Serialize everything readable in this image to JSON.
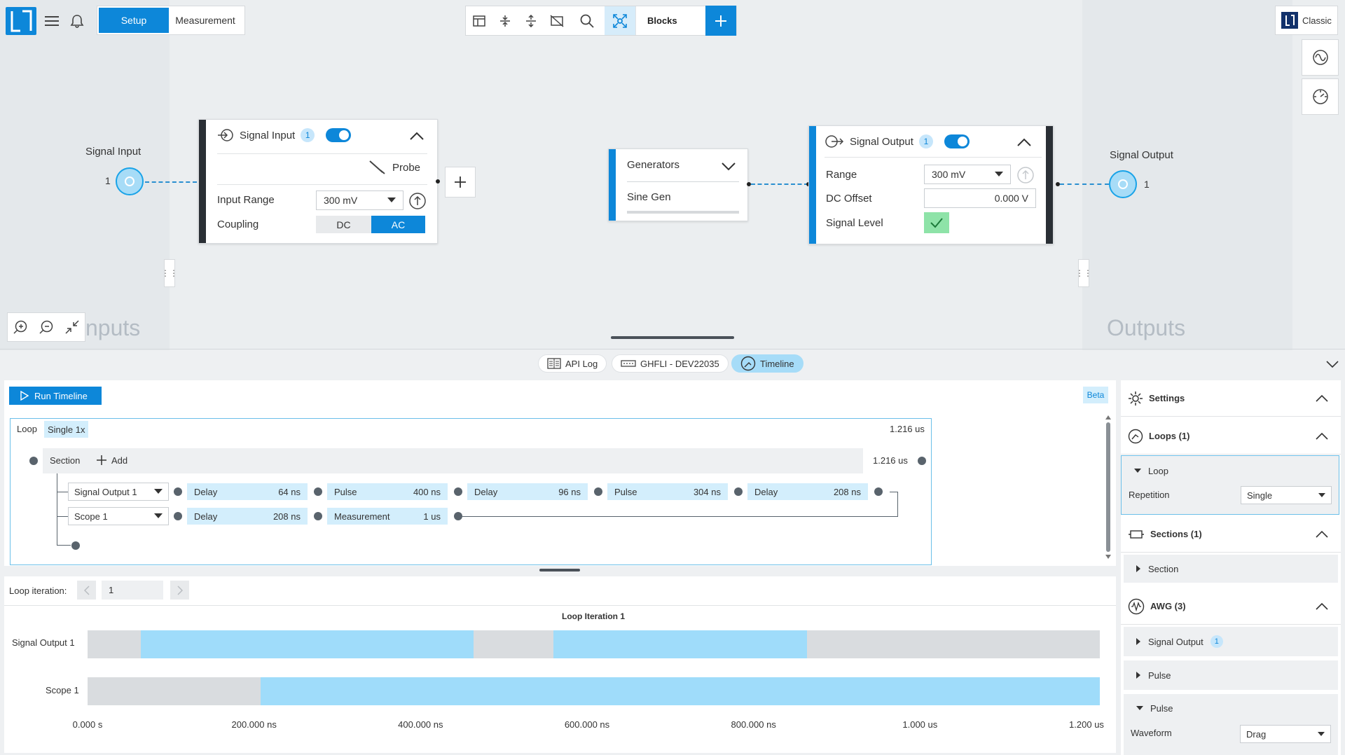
{
  "header": {
    "tabs": [
      "Setup",
      "Measurement"
    ],
    "toolbar_blocks_label": "Blocks",
    "classic_label": "Classic"
  },
  "canvas": {
    "left_area_label": "nputs",
    "right_area_label": "Outputs",
    "signal_input_port": {
      "label": "Signal Input",
      "number": "1"
    },
    "signal_output_port": {
      "label": "Signal Output",
      "number": "1"
    },
    "signal_input_block": {
      "title": "Signal Input",
      "badge": "1",
      "probe_label": "Probe",
      "input_range_label": "Input Range",
      "input_range_value": "300 mV",
      "coupling_label": "Coupling",
      "coupling_options": [
        "DC",
        "AC"
      ],
      "coupling_selected": "AC"
    },
    "generators_block": {
      "title": "Generators",
      "item": "Sine Gen"
    },
    "signal_output_block": {
      "title": "Signal Output",
      "badge": "1",
      "range_label": "Range",
      "range_value": "300 mV",
      "dc_offset_label": "DC Offset",
      "dc_offset_value": "0.000 V",
      "signal_level_label": "Signal Level"
    }
  },
  "bottom_tabs": [
    {
      "label": "API Log",
      "icon": "log-icon"
    },
    {
      "label": "GHFLI - DEV22035",
      "icon": "device-icon"
    },
    {
      "label": "Timeline",
      "icon": "timeline-icon",
      "active": true
    }
  ],
  "timeline": {
    "run_label": "Run Timeline",
    "beta_label": "Beta",
    "loop": {
      "label": "Loop",
      "mode": "Single 1x",
      "duration": "1.216 us"
    },
    "section": {
      "label": "Section",
      "add_label": "Add",
      "duration": "1.216 us"
    },
    "rows": [
      {
        "channel": "Signal Output 1",
        "segments": [
          {
            "label": "Delay",
            "value": "64 ns"
          },
          {
            "label": "Pulse",
            "value": "400 ns"
          },
          {
            "label": "Delay",
            "value": "96 ns"
          },
          {
            "label": "Pulse",
            "value": "304 ns"
          },
          {
            "label": "Delay",
            "value": "208 ns"
          }
        ]
      },
      {
        "channel": "Scope 1",
        "segments": [
          {
            "label": "Delay",
            "value": "208 ns"
          },
          {
            "label": "Measurement",
            "value": "1 us"
          }
        ]
      }
    ]
  },
  "iteration": {
    "label": "Loop iteration:",
    "value": "1",
    "chart_title": "Loop Iteration 1"
  },
  "chart_data": {
    "type": "bar",
    "title": "Loop Iteration 1",
    "x_unit": "ns",
    "xlim": [
      0,
      1216
    ],
    "x_ticks": [
      "0.000 s",
      "200.000 ns",
      "400.000 ns",
      "600.000 ns",
      "800.000 ns",
      "1.000 us",
      "1.200 us"
    ],
    "x_tick_values": [
      0,
      200,
      400,
      600,
      800,
      1000,
      1200
    ],
    "series": [
      {
        "name": "Signal Output 1",
        "segments": [
          {
            "start": 0,
            "end": 64,
            "kind": "delay"
          },
          {
            "start": 64,
            "end": 464,
            "kind": "pulse"
          },
          {
            "start": 464,
            "end": 560,
            "kind": "delay"
          },
          {
            "start": 560,
            "end": 864,
            "kind": "pulse"
          },
          {
            "start": 864,
            "end": 1216,
            "kind": "delay"
          }
        ]
      },
      {
        "name": "Scope 1",
        "segments": [
          {
            "start": 0,
            "end": 208,
            "kind": "delay"
          },
          {
            "start": 208,
            "end": 1216,
            "kind": "measurement"
          }
        ]
      }
    ],
    "colors": {
      "delay": "#d9dcdf",
      "pulse": "#9fdcfa",
      "measurement": "#9fdcfa"
    }
  },
  "settings": {
    "title": "Settings",
    "loops": {
      "title": "Loops (1)",
      "item": "Loop",
      "repetition_label": "Repetition",
      "repetition_value": "Single"
    },
    "sections": {
      "title": "Sections (1)",
      "item": "Section"
    },
    "awg": {
      "title": "AWG (3)",
      "items": [
        "Signal Output",
        "Pulse",
        "Pulse"
      ],
      "badge": "1",
      "waveform_label": "Waveform",
      "waveform_value": "Drag"
    }
  },
  "colors": {
    "accent": "#0d87d9",
    "port": "#a7dcf7",
    "success": "#8ee3a8"
  }
}
